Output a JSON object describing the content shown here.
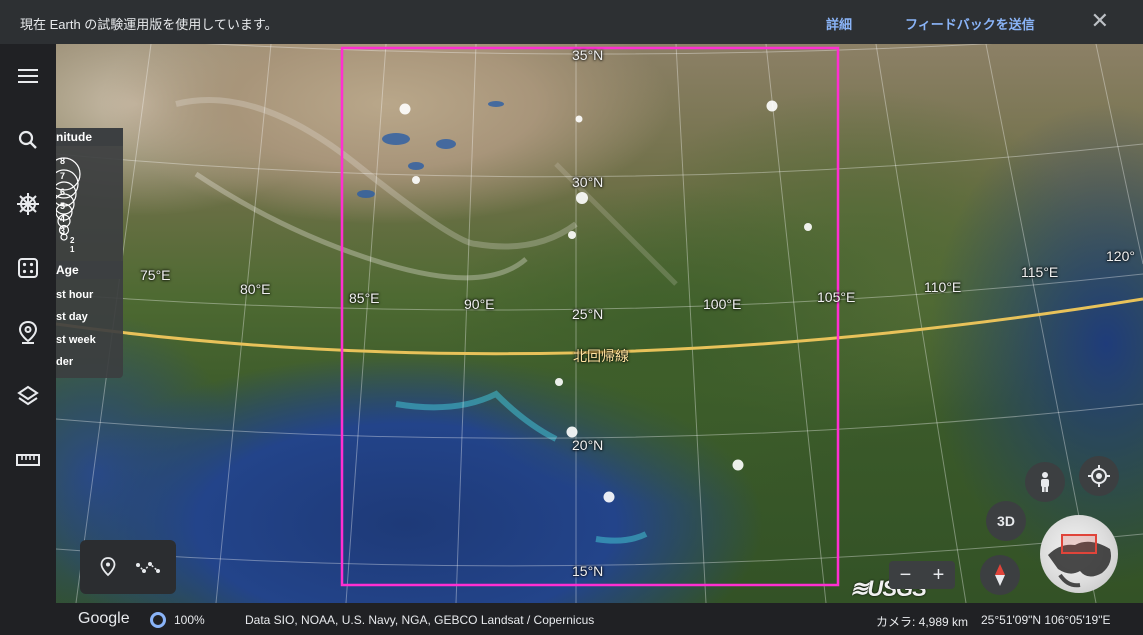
{
  "banner": {
    "message": "現在 Earth の試験運用版を使用しています。",
    "details_link": "詳細",
    "feedback_link": "フィードバックを送信",
    "close_icon": "close-icon"
  },
  "sidebar": {
    "items": [
      {
        "name": "menu-icon"
      },
      {
        "name": "search-icon"
      },
      {
        "name": "voyager-wheel-icon"
      },
      {
        "name": "feeling-lucky-dice-icon"
      },
      {
        "name": "projects-pin-icon"
      },
      {
        "name": "map-style-layers-icon"
      },
      {
        "name": "measure-ruler-icon"
      }
    ]
  },
  "legend": {
    "magnitude_title": "nitude",
    "magnitudes": [
      "8",
      "7",
      "6",
      "5",
      "4",
      "3",
      "2",
      "1"
    ],
    "age_title": "Age",
    "ages": [
      "st hour",
      "st day",
      "st week",
      "der"
    ]
  },
  "map_labels": {
    "lat35": "35°N",
    "lat30": "30°N",
    "lat25": "25°N",
    "lat20": "20°N",
    "lat15": "15°N",
    "lon75": "75°E",
    "lon80": "80°E",
    "lon85": "85°E",
    "lon90": "90°E",
    "lon100": "100°E",
    "lon105": "105°E",
    "lon110": "110°E",
    "lon115": "115°E",
    "lon120": "120°",
    "tropic": "北回帰線"
  },
  "controls": {
    "zoom_out": "−",
    "zoom_in": "+",
    "three_d": "3D",
    "usgs": "≋USGS"
  },
  "bottom_bar": {
    "google": "Google",
    "loading": "100%",
    "attribution": "Data SIO, NOAA, U.S. Navy, NGA, GEBCO   Landsat / Copernicus",
    "camera": "カメラ: 4,989 km",
    "coords": "25°51'09\"N 106°05'19\"E"
  },
  "colors": {
    "selection_box": "#ff2fd1",
    "tropic_line": "#e8c25a",
    "link": "#8ab4f8"
  }
}
